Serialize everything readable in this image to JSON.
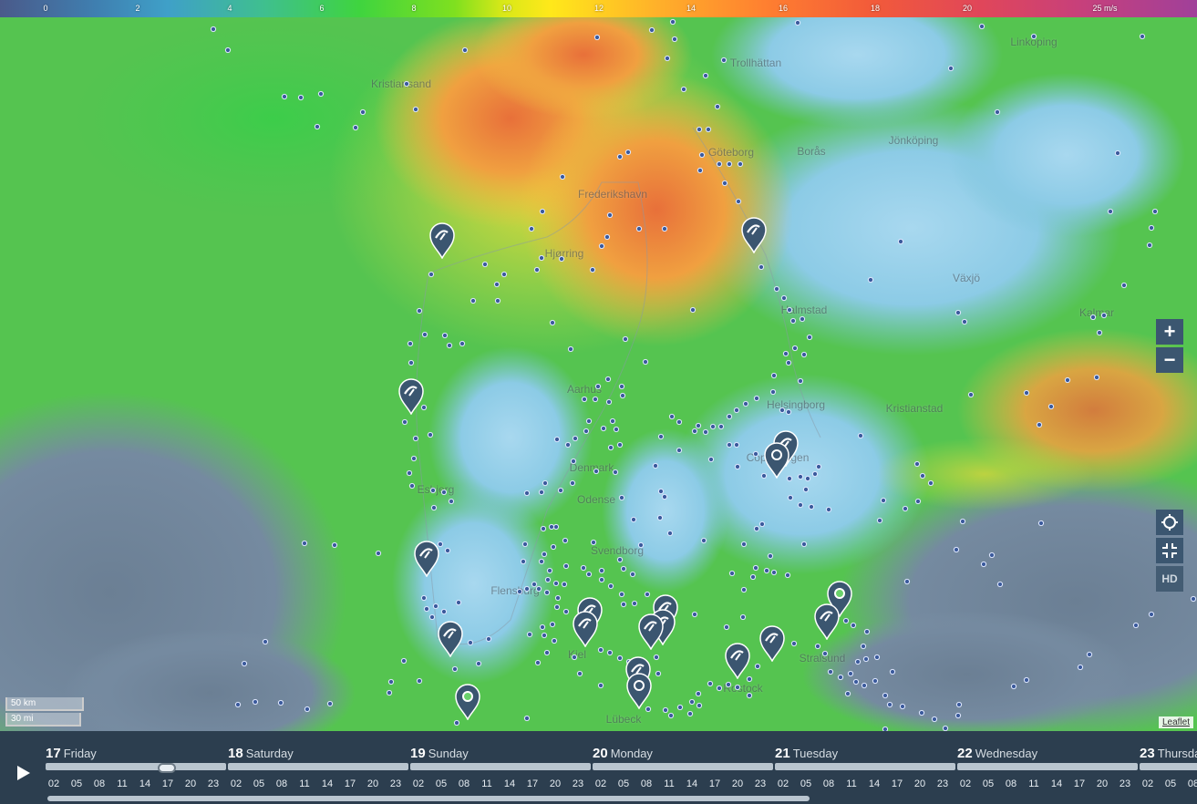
{
  "legend": {
    "ticks": [
      "0",
      "2",
      "4",
      "6",
      "8",
      "10",
      "12",
      "14",
      "16",
      "18",
      "20",
      "25 m/s"
    ]
  },
  "places": [
    {
      "name": "Linköping"
    },
    {
      "name": "Kristiansand"
    },
    {
      "name": "Trollhättan"
    },
    {
      "name": "Göteborg"
    },
    {
      "name": "Borås"
    },
    {
      "name": "Jönköping"
    },
    {
      "name": "Frederikshavn"
    },
    {
      "name": "Hjørring"
    },
    {
      "name": "Växjö"
    },
    {
      "name": "Kalmar"
    },
    {
      "name": "Halmstad"
    },
    {
      "name": "Aarhus"
    },
    {
      "name": "Helsingborg"
    },
    {
      "name": "Kristianstad"
    },
    {
      "name": "Copenhagen"
    },
    {
      "name": "Esbjerg"
    },
    {
      "name": "Denmark"
    },
    {
      "name": "Odense"
    },
    {
      "name": "Svendborg"
    },
    {
      "name": "Flensburg"
    },
    {
      "name": "Kiel"
    },
    {
      "name": "Stralsund"
    },
    {
      "name": "Rostock"
    },
    {
      "name": "Lübeck"
    }
  ],
  "controls": {
    "zoom_in": "+",
    "zoom_out": "−",
    "hd": "HD"
  },
  "scale": {
    "km": "50 km",
    "mi": "30 mi"
  },
  "attribution": "Leaflet",
  "timeline": {
    "hours": [
      "02",
      "05",
      "08",
      "11",
      "14",
      "17",
      "20",
      "23"
    ],
    "days": [
      {
        "num": "17",
        "name": "Friday"
      },
      {
        "num": "18",
        "name": "Saturday"
      },
      {
        "num": "19",
        "name": "Sunday"
      },
      {
        "num": "20",
        "name": "Monday"
      },
      {
        "num": "21",
        "name": "Tuesday"
      },
      {
        "num": "22",
        "name": "Wednesday"
      },
      {
        "num": "23",
        "name": "Thursday"
      }
    ]
  },
  "colors": {
    "panel": "#2c3e4f",
    "pin": "#3b5670",
    "accent": "#ffffff"
  }
}
